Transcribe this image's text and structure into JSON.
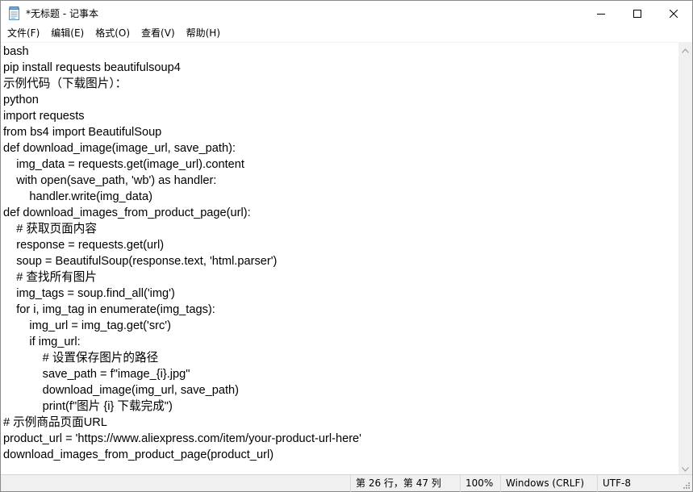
{
  "window": {
    "title": "*无标题 - 记事本",
    "icon": "notepad-icon",
    "controls": {
      "minimize": "minimize-icon",
      "maximize": "maximize-icon",
      "close": "close-icon"
    }
  },
  "menu": {
    "items": [
      "文件(F)",
      "编辑(E)",
      "格式(O)",
      "查看(V)",
      "帮助(H)"
    ]
  },
  "editor": {
    "lines": [
      "bash",
      "pip install requests beautifulsoup4",
      "示例代码（下载图片）：",
      "python",
      "import requests",
      "from bs4 import BeautifulSoup",
      "def download_image(image_url, save_path):",
      "    img_data = requests.get(image_url).content",
      "    with open(save_path, 'wb') as handler:",
      "        handler.write(img_data)",
      "def download_images_from_product_page(url):",
      "    # 获取页面内容",
      "    response = requests.get(url)",
      "    soup = BeautifulSoup(response.text, 'html.parser')",
      "    # 查找所有图片",
      "    img_tags = soup.find_all('img')",
      "    for i, img_tag in enumerate(img_tags):",
      "        img_url = img_tag.get('src')",
      "        if img_url:",
      "            # 设置保存图片的路径",
      "            save_path = f\"image_{i}.jpg\"",
      "            download_image(img_url, save_path)",
      "            print(f\"图片 {i} 下载完成\")",
      "# 示例商品页面URL",
      "product_url = 'https://www.aliexpress.com/item/your-product-url-here'",
      "download_images_from_product_page(product_url)"
    ]
  },
  "status": {
    "position": "第 26 行，第 47 列",
    "zoom": "100%",
    "line_ending": "Windows (CRLF)",
    "encoding": "UTF-8"
  },
  "colors": {
    "window_bg": "#ffffff",
    "statusbar_bg": "#f0f0f0",
    "border": "#8a8a8a",
    "text": "#000000"
  }
}
